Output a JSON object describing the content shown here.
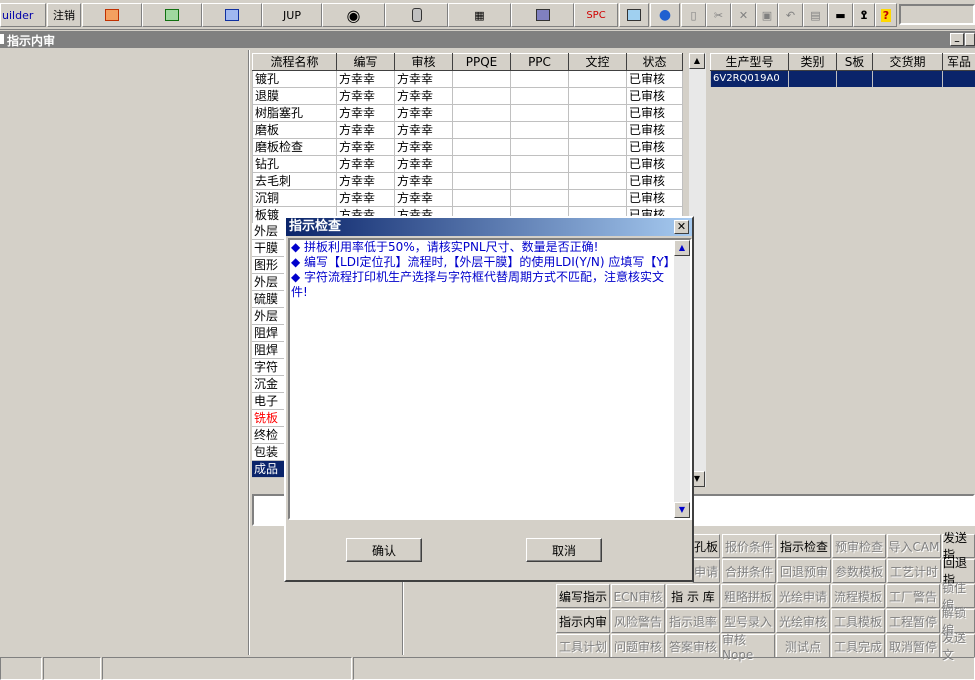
{
  "toolbar": {
    "builder": "uilder",
    "logout": "注销",
    "jup": "JUP",
    "spc": "SPC",
    "search_value": ""
  },
  "window": {
    "title": "指示内审"
  },
  "flow_table": {
    "headers": [
      "流程名称",
      "编写",
      "审核",
      "PPQE",
      "PPC",
      "文控",
      "状态"
    ],
    "rows": [
      {
        "name": "镀孔",
        "writer": "方幸幸",
        "reviewer": "方幸幸",
        "ppqe": "",
        "ppc": "",
        "doc": "",
        "status": "已审核"
      },
      {
        "name": "退膜",
        "writer": "方幸幸",
        "reviewer": "方幸幸",
        "ppqe": "",
        "ppc": "",
        "doc": "",
        "status": "已审核"
      },
      {
        "name": "树脂塞孔",
        "writer": "方幸幸",
        "reviewer": "方幸幸",
        "ppqe": "",
        "ppc": "",
        "doc": "",
        "status": "已审核"
      },
      {
        "name": "磨板",
        "writer": "方幸幸",
        "reviewer": "方幸幸",
        "ppqe": "",
        "ppc": "",
        "doc": "",
        "status": "已审核"
      },
      {
        "name": "磨板检查",
        "writer": "方幸幸",
        "reviewer": "方幸幸",
        "ppqe": "",
        "ppc": "",
        "doc": "",
        "status": "已审核"
      },
      {
        "name": "钻孔",
        "writer": "方幸幸",
        "reviewer": "方幸幸",
        "ppqe": "",
        "ppc": "",
        "doc": "",
        "status": "已审核"
      },
      {
        "name": "去毛刺",
        "writer": "方幸幸",
        "reviewer": "方幸幸",
        "ppqe": "",
        "ppc": "",
        "doc": "",
        "status": "已审核"
      },
      {
        "name": "沉铜",
        "writer": "方幸幸",
        "reviewer": "方幸幸",
        "ppqe": "",
        "ppc": "",
        "doc": "",
        "status": "已审核"
      },
      {
        "name": "板镀",
        "writer": "方幸幸",
        "reviewer": "方幸幸",
        "ppqe": "",
        "ppc": "",
        "doc": "",
        "status": "已审核"
      }
    ],
    "hidden_rows": [
      "外层",
      "干膜",
      "图形",
      "外层",
      "硫膜",
      "外层",
      "阻焊",
      "阻焊",
      "字符",
      "沉金",
      "电子",
      "铣板",
      "终检",
      "包装",
      "成品"
    ]
  },
  "order_table": {
    "headers": [
      "生产型号",
      "类别",
      "S板",
      "交货期",
      "军品"
    ],
    "rows": [
      {
        "model": "6V2RQ019A0",
        "category": "",
        "s_board": "",
        "delivery": "",
        "military": ""
      }
    ]
  },
  "dialog": {
    "title": "指示检查",
    "messages": [
      "◆ 拼板利用率低于50%，请核实PNL尺寸、数量是否正确!",
      "◆ 编写【LDI定位孔】流程时,【外层干膜】的使用LDI(Y/N) 应填写【Y】",
      "◆ 字符流程打印机生产选择与字符框代替周期方式不匹配，注意核实文件!"
    ],
    "ok_label": "确认",
    "cancel_label": "取消"
  },
  "buttons": {
    "row1": [
      "孔板",
      "报价条件",
      "指示检查",
      "预审检查",
      "导入CAM",
      "发送指"
    ],
    "row2": [
      "申请",
      "合拼条件",
      "回退预审",
      "参数模板",
      "工艺计时",
      "回退指"
    ],
    "row3": [
      "编写指示",
      "ECN审核",
      "指 示 库",
      "粗略拼板",
      "光绘申请",
      "流程模板",
      "工厂警告",
      "锁住编"
    ],
    "row4": [
      "指示内审",
      "风险警告",
      "指示退率",
      "型号录入",
      "光绘审核",
      "工具模板",
      "工程暂停",
      "解锁编"
    ],
    "row5": [
      "工具计划",
      "问题审核",
      "答案审核",
      "审核Nope",
      "测试点",
      "工具完成",
      "取消暂停",
      "发送文"
    ]
  },
  "colors": {
    "selection": "#0a246a",
    "red_row": "#ff0000",
    "message_text": "#0000cc"
  }
}
